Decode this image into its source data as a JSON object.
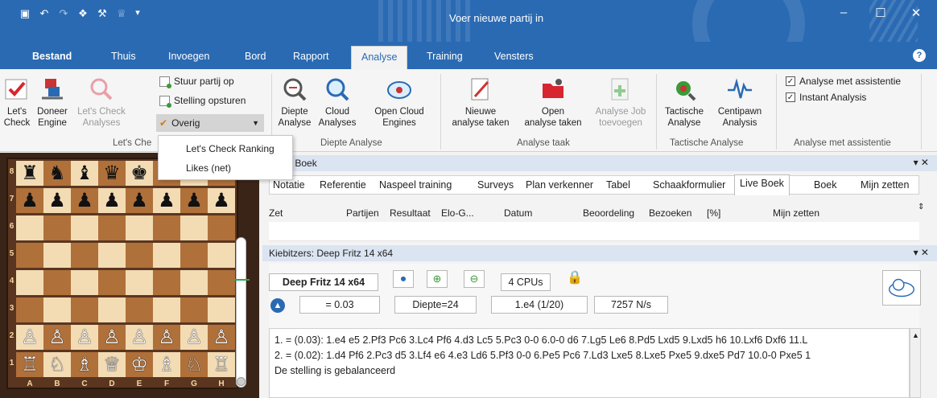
{
  "window": {
    "title": "Voer nieuwe partij in"
  },
  "menu": [
    "Bestand",
    "Thuis",
    "Invoegen",
    "Bord",
    "Rapport",
    "Analyse",
    "Training",
    "Vensters"
  ],
  "menu_active": "Analyse",
  "ribbon": {
    "lets_check": {
      "line1": "Let's",
      "line2": "Check"
    },
    "doneer": {
      "line1": "Doneer",
      "line2": "Engine"
    },
    "lc_analyses": {
      "line1": "Let's Check",
      "line2": "Analyses"
    },
    "stuur": "Stuur partij op",
    "stelling": "Stelling opsturen",
    "overig": "Overig",
    "group_letscheck": "Let's Che",
    "diepte": {
      "line1": "Diepte",
      "line2": "Analyse"
    },
    "cloud": {
      "line1": "Cloud",
      "line2": "Analyses"
    },
    "open_cloud": {
      "line1": "Open Cloud",
      "line2": "Engines"
    },
    "group_diepte": "Diepte Analyse",
    "nieuwe": {
      "line1": "Nieuwe",
      "line2": "analyse taken"
    },
    "open": {
      "line1": "Open",
      "line2": "analyse taken"
    },
    "job": {
      "line1": "Analyse Job",
      "line2": "toevoegen"
    },
    "group_taak": "Analyse taak",
    "tactische": {
      "line1": "Tactische",
      "line2": "Analyse"
    },
    "centipawn": {
      "line1": "Centipawn",
      "line2": "Analysis"
    },
    "group_tactisch": "Tactische Analyse",
    "chk_assist": "Analyse met assistentie",
    "chk_instant": "Instant Analysis",
    "group_assist": "Analyse met assistentie"
  },
  "dropdown": [
    "Let's Check Ranking",
    "Likes (net)"
  ],
  "board": {
    "ranks": [
      "8",
      "7",
      "6",
      "5",
      "4",
      "3",
      "2",
      "1"
    ],
    "files": [
      "A",
      "B",
      "C",
      "D",
      "E",
      "F",
      "G",
      "H"
    ],
    "pieces": [
      [
        "♜",
        "♞",
        "♝",
        "♛",
        "♚",
        "♝",
        "♞",
        "♜"
      ],
      [
        "♟",
        "♟",
        "♟",
        "♟",
        "♟",
        "♟",
        "♟",
        "♟"
      ],
      [
        "",
        "",
        "",
        "",
        "",
        "",
        "",
        ""
      ],
      [
        "",
        "",
        "",
        "",
        "",
        "",
        "",
        ""
      ],
      [
        "",
        "",
        "",
        "",
        "",
        "",
        "",
        ""
      ],
      [
        "",
        "",
        "",
        "",
        "",
        "",
        "",
        ""
      ],
      [
        "♙",
        "♙",
        "♙",
        "♙",
        "♙",
        "♙",
        "♙",
        "♙"
      ],
      [
        "♖",
        "♘",
        "♗",
        "♕",
        "♔",
        "♗",
        "♘",
        "♖"
      ]
    ]
  },
  "notation_pane": {
    "title": "tie + Boek"
  },
  "tabs": [
    "Notatie",
    "Referentie",
    "Naspeel training",
    "Surveys",
    "Plan verkenner",
    "Tabel",
    "Schaakformulier",
    "Live Boek",
    "Boek",
    "Mijn zetten"
  ],
  "tab_active": "Live Boek",
  "columns": [
    "Zet",
    "Partijen",
    "Resultaat",
    "Elo-G...",
    "Datum",
    "Beoordeling",
    "Bezoeken",
    "[%]",
    "Mijn zetten"
  ],
  "kibitz": {
    "title": "Kiebitzers: Deep Fritz 14 x64",
    "engine": "Deep Fritz 14 x64",
    "cpus": "4 CPUs",
    "eval": "= 0.03",
    "depth": "Diepte=24",
    "move": "1.e4 (1/20)",
    "speed": "7257 N/s",
    "lines": [
      "1. = (0.03): 1.e4 e5 2.Pf3 Pc6 3.Lc4 Pf6 4.d3 Lc5 5.Pc3 0-0 6.0-0 d6 7.Lg5 Le6 8.Pd5 Lxd5 9.Lxd5 h6 10.Lxf6 Dxf6 11.L",
      "2. = (0.02): 1.d4 Pf6 2.Pc3 d5 3.Lf4 e6 4.e3 Ld6 5.Pf3 0-0 6.Pe5 Pc6 7.Ld3 Lxe5 8.Lxe5 Pxe5 9.dxe5 Pd7 10.0-0 Pxe5 1",
      "De stelling is gebalanceerd"
    ]
  }
}
